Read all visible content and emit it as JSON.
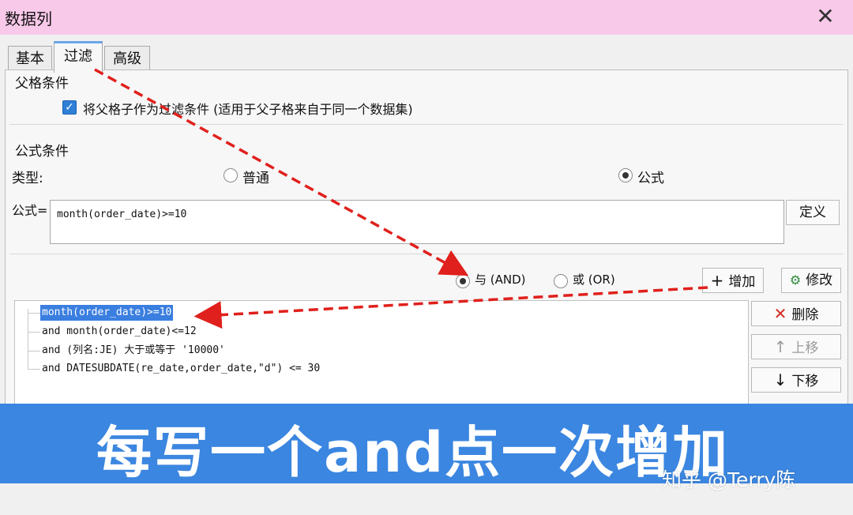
{
  "window": {
    "title": "数据列",
    "close_glyph": "✕"
  },
  "tabs": [
    {
      "label": "基本"
    },
    {
      "label": "过滤"
    },
    {
      "label": "高级"
    }
  ],
  "parent_condition": {
    "group_label": "父格条件",
    "checkbox_label": "将父格子作为过滤条件 (适用于父子格来自于同一个数据集)",
    "checked": true
  },
  "formula_condition": {
    "group_label": "公式条件",
    "type_label": "类型:",
    "type_options": [
      {
        "label": "普通",
        "checked": false
      },
      {
        "label": "公式",
        "checked": true
      }
    ],
    "formula_label": "公式=",
    "formula_value": "month(order_date)>=10",
    "define_button": "定义"
  },
  "logic": {
    "options": [
      {
        "label": "与 (AND)",
        "checked": true
      },
      {
        "label": "或 (OR)",
        "checked": false
      }
    ],
    "add_button": "增加",
    "modify_button": "修改"
  },
  "conditions": [
    "month(order_date)>=10",
    "and month(order_date)<=12",
    "and (列名:JE) 大于或等于 '10000'",
    "and DATESUBDATE(re_date,order_date,\"d\") <= 30"
  ],
  "side_buttons": {
    "delete": "删除",
    "up": "上移",
    "down": "下移"
  },
  "overlay": {
    "caption": "每写一个and点一次增加",
    "watermark": "知乎 @Terry陈"
  },
  "colors": {
    "titlebar": "#f9c9ea",
    "banner": "#3b86e0",
    "selection": "#3a7ee0",
    "arrow": "#e0201c"
  }
}
